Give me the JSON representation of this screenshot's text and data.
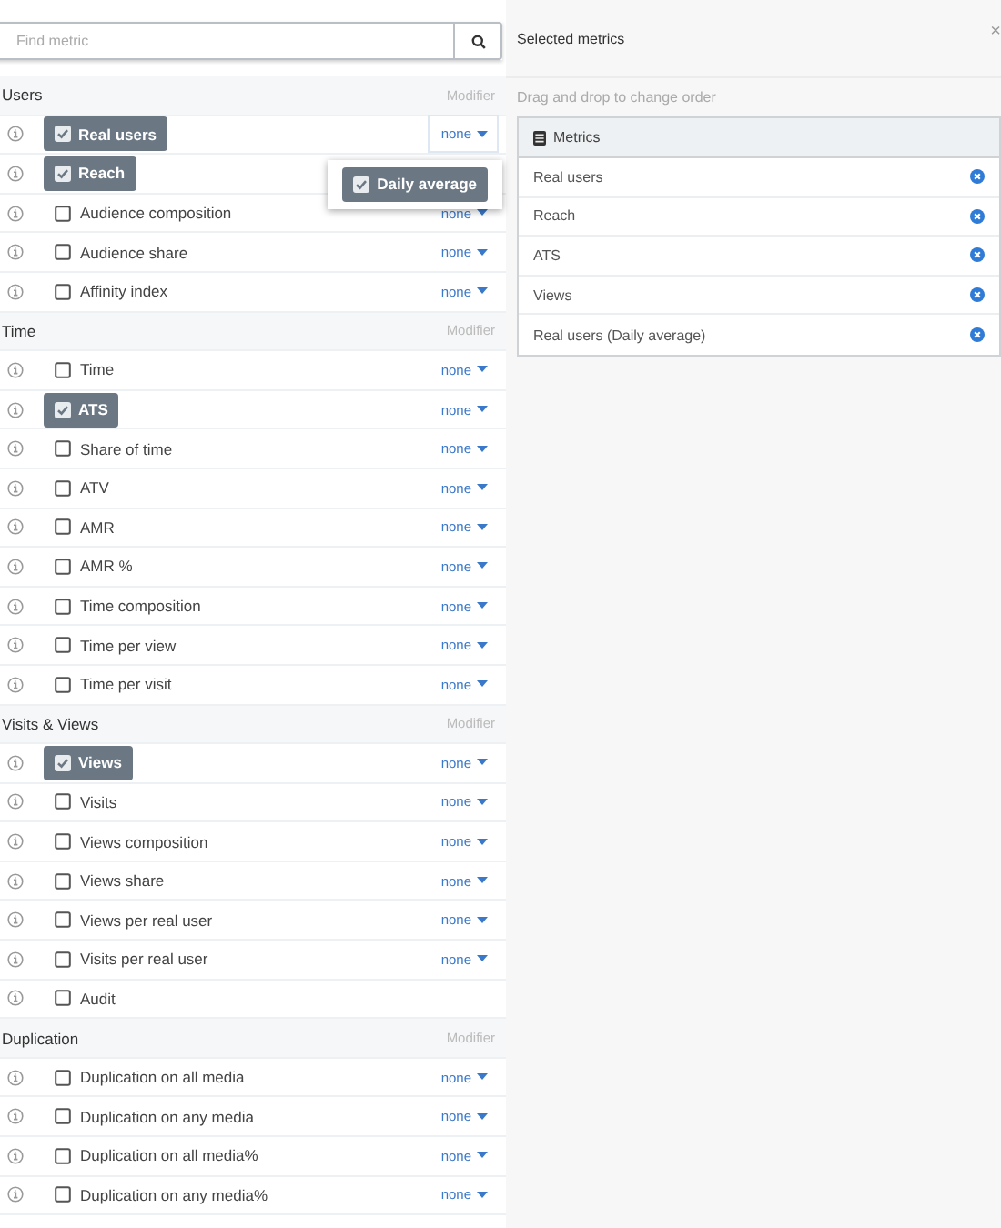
{
  "search": {
    "placeholder": "Find metric"
  },
  "groups": [
    {
      "name": "Users",
      "modifier_heading": "Modifier",
      "metrics": [
        {
          "label": "Real users",
          "checked": true,
          "modifier": "none",
          "menu_open": true,
          "menu": [
            {
              "label": "Daily average",
              "checked": true
            }
          ]
        },
        {
          "label": "Reach",
          "checked": true
        },
        {
          "label": "Audience composition",
          "checked": false,
          "modifier": "none",
          "menu_open": false
        },
        {
          "label": "Audience share",
          "checked": false,
          "modifier": "none",
          "menu_open": false
        },
        {
          "label": "Affinity index",
          "checked": false,
          "modifier": "none",
          "menu_open": false
        }
      ]
    },
    {
      "name": "Time",
      "modifier_heading": "Modifier",
      "metrics": [
        {
          "label": "Time",
          "checked": false,
          "modifier": "none",
          "menu_open": false
        },
        {
          "label": "ATS",
          "checked": true,
          "modifier": "none",
          "menu_open": false
        },
        {
          "label": "Share of time",
          "checked": false,
          "modifier": "none",
          "menu_open": false
        },
        {
          "label": "ATV",
          "checked": false,
          "modifier": "none",
          "menu_open": false
        },
        {
          "label": "AMR",
          "checked": false,
          "modifier": "none",
          "menu_open": false
        },
        {
          "label": "AMR %",
          "checked": false,
          "modifier": "none",
          "menu_open": false
        },
        {
          "label": "Time composition",
          "checked": false,
          "modifier": "none",
          "menu_open": false
        },
        {
          "label": "Time per view",
          "checked": false,
          "modifier": "none",
          "menu_open": false
        },
        {
          "label": "Time per visit",
          "checked": false,
          "modifier": "none",
          "menu_open": false
        }
      ]
    },
    {
      "name": "Visits & Views",
      "modifier_heading": "Modifier",
      "metrics": [
        {
          "label": "Views",
          "checked": true,
          "modifier": "none",
          "menu_open": false
        },
        {
          "label": "Visits",
          "checked": false,
          "modifier": "none",
          "menu_open": false
        },
        {
          "label": "Views composition",
          "checked": false,
          "modifier": "none",
          "menu_open": false
        },
        {
          "label": "Views share",
          "checked": false,
          "modifier": "none",
          "menu_open": false
        },
        {
          "label": "Views per real user",
          "checked": false,
          "modifier": "none",
          "menu_open": false
        },
        {
          "label": "Visits per real user",
          "checked": false,
          "modifier": "none",
          "menu_open": false
        },
        {
          "label": "Audit",
          "checked": false
        }
      ]
    },
    {
      "name": "Duplication",
      "modifier_heading": "Modifier",
      "metrics": [
        {
          "label": "Duplication on all media",
          "checked": false,
          "modifier": "none",
          "menu_open": false
        },
        {
          "label": "Duplication on any media",
          "checked": false,
          "modifier": "none",
          "menu_open": false
        },
        {
          "label": "Duplication on all media%",
          "checked": false,
          "modifier": "none",
          "menu_open": false
        },
        {
          "label": "Duplication on any media%",
          "checked": false,
          "modifier": "none",
          "menu_open": false
        }
      ]
    }
  ],
  "selected_panel": {
    "title": "Selected metrics",
    "close": "×",
    "hint": "Drag and drop to change order",
    "box_title": "Metrics",
    "items": [
      {
        "label": "Real users"
      },
      {
        "label": "Reach"
      },
      {
        "label": "ATS"
      },
      {
        "label": "Views"
      },
      {
        "label": "Real users (Daily average)"
      }
    ]
  }
}
